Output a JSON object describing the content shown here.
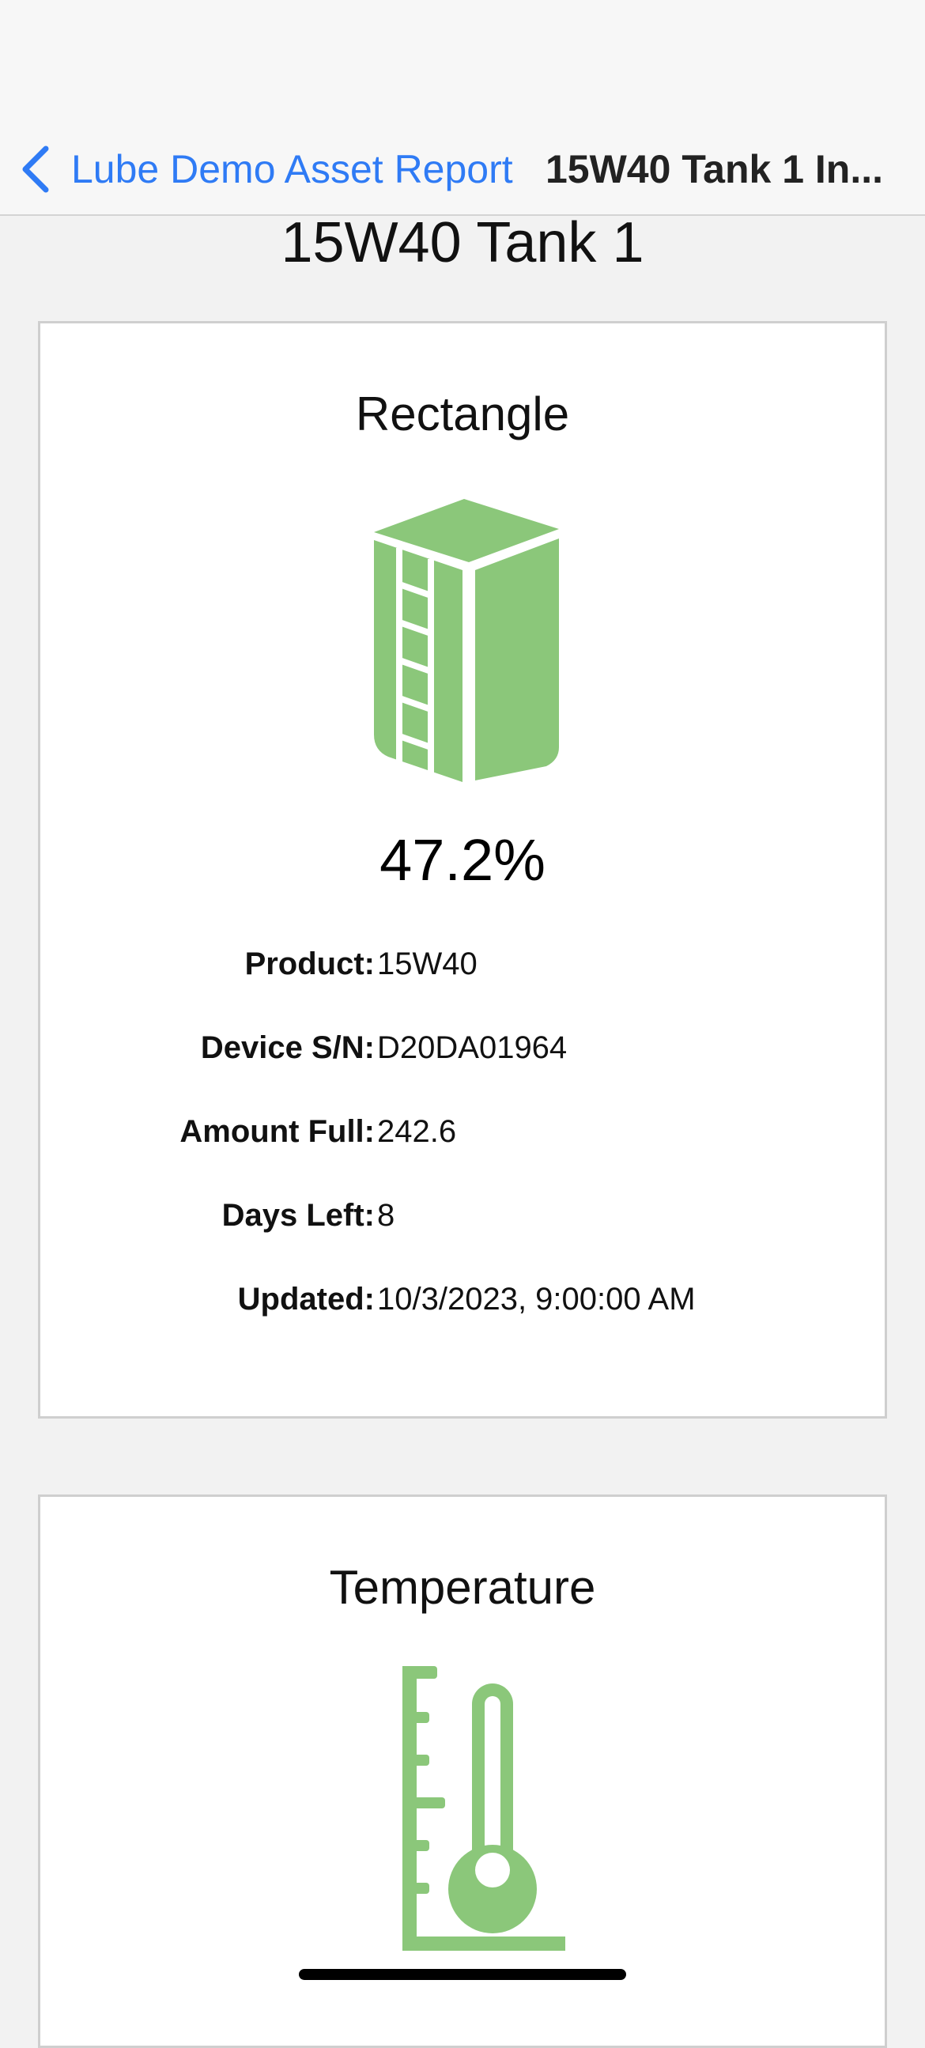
{
  "nav": {
    "back_label": "Lube Demo Asset Report",
    "title": "15W40 Tank 1 In..."
  },
  "page": {
    "title": "15W40 Tank 1"
  },
  "tank_card": {
    "title": "Rectangle",
    "icon": "rectangle-tank-icon",
    "percent": "47.2%",
    "details": [
      {
        "label": "Product:",
        "value": "15W40"
      },
      {
        "label": "Device S/N:",
        "value": "D20DA01964"
      },
      {
        "label": "Amount Full:",
        "value": "242.6"
      },
      {
        "label": "Days Left:",
        "value": "8"
      },
      {
        "label": "Updated:",
        "value": "10/3/2023, 9:00:00 AM"
      }
    ]
  },
  "temperature_card": {
    "title": "Temperature",
    "icon": "thermometer-icon"
  },
  "colors": {
    "accent": "#2f7bf5",
    "icon_green": "#8bc77a",
    "background": "#f2f2f2",
    "card_border": "#cfcfcf"
  }
}
